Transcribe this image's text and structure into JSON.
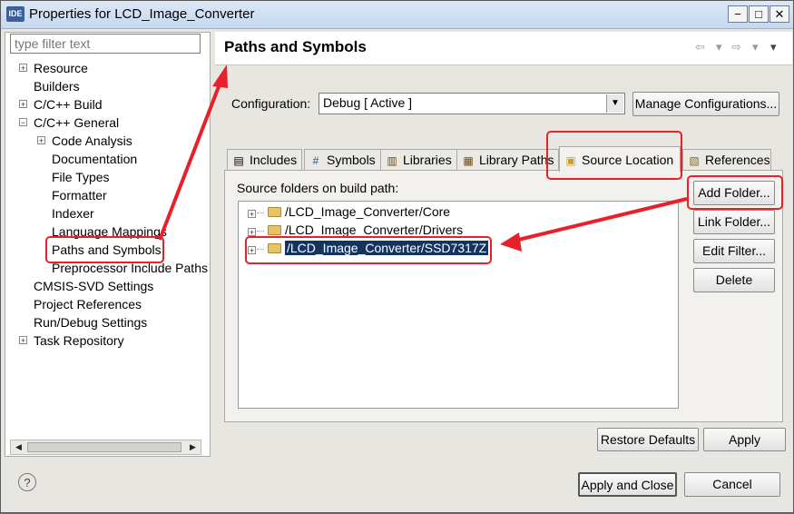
{
  "window": {
    "app_icon": "IDE",
    "title": "Properties for LCD_Image_Converter",
    "min": "−",
    "max": "□",
    "close": "✕"
  },
  "sidebar": {
    "filter_placeholder": "type filter text",
    "items": [
      {
        "label": "Resource",
        "expander": "+"
      },
      {
        "label": "Builders"
      },
      {
        "label": "C/C++ Build",
        "expander": "+"
      },
      {
        "label": "C/C++ General",
        "expander": "−"
      },
      {
        "label": "Code Analysis",
        "expander": "+"
      },
      {
        "label": "Documentation"
      },
      {
        "label": "File Types"
      },
      {
        "label": "Formatter"
      },
      {
        "label": "Indexer"
      },
      {
        "label": "Language Mappings"
      },
      {
        "label": "Paths and Symbols"
      },
      {
        "label": "Preprocessor Include Paths"
      },
      {
        "label": "CMSIS-SVD Settings"
      },
      {
        "label": "Project References"
      },
      {
        "label": "Run/Debug Settings"
      },
      {
        "label": "Task Repository",
        "expander": "+"
      }
    ]
  },
  "page": {
    "title": "Paths and Symbols"
  },
  "nav": {
    "back": "⇦",
    "back_menu": "▾",
    "forward": "⇨",
    "forward_menu": "▾",
    "menu": "▾"
  },
  "configuration": {
    "label": "Configuration:",
    "value": "Debug  [ Active ]",
    "arrow": "▼",
    "manage_button": "Manage Configurations..."
  },
  "tabs": [
    {
      "label": "Includes",
      "icon": "includes-icon",
      "glyph": "▤"
    },
    {
      "label": "Symbols",
      "icon": "hash-icon",
      "glyph": "#"
    },
    {
      "label": "Libraries",
      "icon": "libraries-icon",
      "glyph": "▥"
    },
    {
      "label": "Library Paths",
      "icon": "library-paths-icon",
      "glyph": "▦"
    },
    {
      "label": "Source Location",
      "icon": "folder-icon",
      "glyph": "▣"
    },
    {
      "label": "References",
      "icon": "references-icon",
      "glyph": "▧"
    }
  ],
  "source": {
    "label": "Source folders on build path:",
    "folders": [
      {
        "path": "/LCD_Image_Converter/Core"
      },
      {
        "path": "/LCD_Image_Converter/Drivers"
      },
      {
        "path": "/LCD_Image_Converter/SSD7317Z"
      }
    ],
    "tree_expander": "+",
    "buttons": {
      "add": "Add Folder...",
      "link": "Link Folder...",
      "edit": "Edit Filter...",
      "delete": "Delete"
    }
  },
  "footer": {
    "restore": "Restore Defaults",
    "apply": "Apply",
    "apply_close": "Apply and Close",
    "cancel": "Cancel",
    "help": "?"
  },
  "scroll": {
    "left": "◀",
    "right": "▶"
  },
  "colors": {
    "highlight": "#e8202a",
    "selection": "#14345f"
  }
}
